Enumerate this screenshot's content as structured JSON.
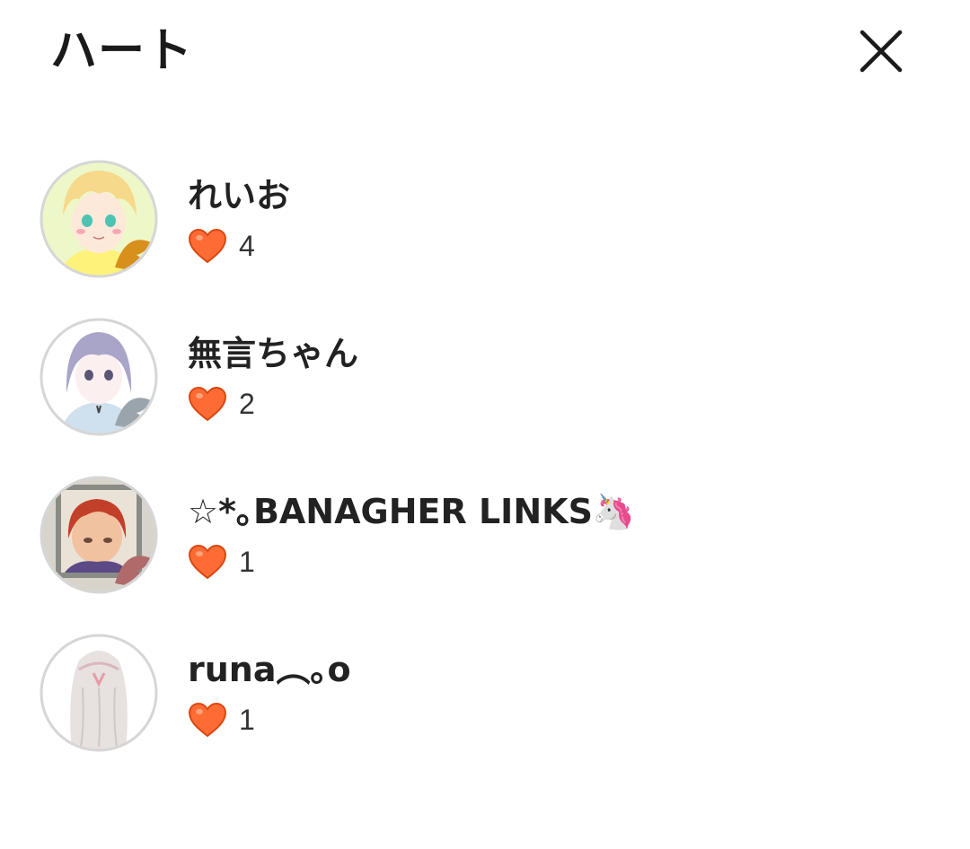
{
  "header": {
    "title": "ハート",
    "close_icon": "close-icon"
  },
  "colors": {
    "heart": "#ff6b35",
    "heart_outline": "#d9480f",
    "avatar_border": "#d6d6d6",
    "text": "#222222"
  },
  "users": [
    {
      "name": "れいお",
      "hearts": "4",
      "avatar": "anime-boy-blonde"
    },
    {
      "name": "無言ちゃん",
      "hearts": "2",
      "avatar": "anime-girl-lavender"
    },
    {
      "name": "☆*｡BANAGHER LINKS🦄",
      "hearts": "1",
      "avatar": "drawing-redhead"
    },
    {
      "name": "runa︵｡o",
      "hearts": "1",
      "avatar": "sketch-girl-back"
    }
  ]
}
